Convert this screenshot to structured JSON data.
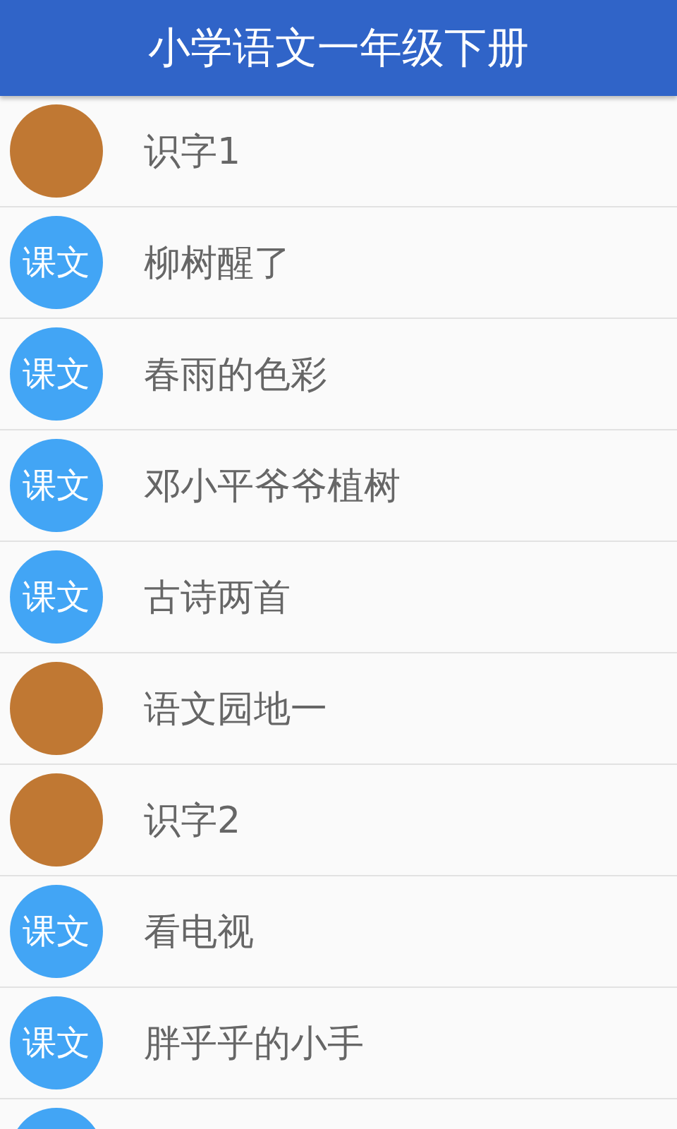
{
  "app_bar": {
    "title": "小学语文一年级下册"
  },
  "lessons": [
    {
      "kind": "unit",
      "title": "识字1"
    },
    {
      "kind": "lesson",
      "badge": "课文",
      "title": "柳树醒了"
    },
    {
      "kind": "lesson",
      "badge": "课文",
      "title": "春雨的色彩"
    },
    {
      "kind": "lesson",
      "badge": "课文",
      "title": "邓小平爷爷植树"
    },
    {
      "kind": "lesson",
      "badge": "课文",
      "title": "古诗两首"
    },
    {
      "kind": "unit",
      "title": "语文园地一"
    },
    {
      "kind": "unit",
      "title": "识字2"
    },
    {
      "kind": "lesson",
      "badge": "课文",
      "title": "看电视"
    },
    {
      "kind": "lesson",
      "badge": "课文",
      "title": "胖乎乎的小手"
    },
    {
      "kind": "lesson"
    }
  ]
}
